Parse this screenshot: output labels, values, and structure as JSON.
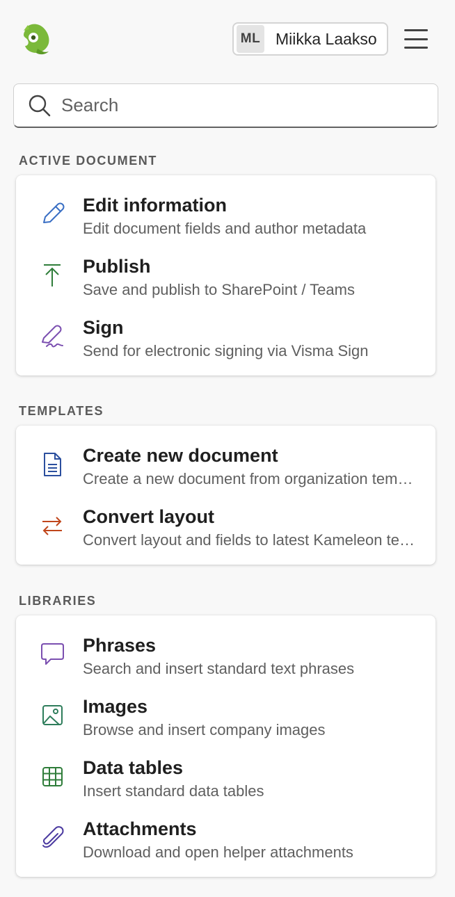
{
  "header": {
    "user_initials": "ML",
    "user_name": "Miikka Laakso",
    "logo_icon": "chameleon-logo",
    "menu_icon": "hamburger-menu-icon"
  },
  "search": {
    "placeholder": "Search"
  },
  "sections": {
    "active_document": {
      "title": "ACTIVE DOCUMENT",
      "items": [
        {
          "title": "Edit information",
          "desc": "Edit document fields and author metadata",
          "icon": "pencil-icon",
          "color": "#3a6fc4"
        },
        {
          "title": "Publish",
          "desc": "Save and publish to SharePoint / Teams",
          "icon": "upload-arrow-icon",
          "color": "#2f7d3a"
        },
        {
          "title": "Sign",
          "desc": "Send for electronic signing via Visma Sign",
          "icon": "signature-pen-icon",
          "color": "#7b4fb0"
        }
      ]
    },
    "templates": {
      "title": "TEMPLATES",
      "items": [
        {
          "title": "Create new document",
          "desc": "Create a new document from organization templates",
          "icon": "document-icon",
          "color": "#2b4f9e"
        },
        {
          "title": "Convert layout",
          "desc": "Convert layout and fields to latest Kameleon templates",
          "icon": "swap-arrows-icon",
          "color": "#c0461b"
        }
      ]
    },
    "libraries": {
      "title": "LIBRARIES",
      "items": [
        {
          "title": "Phrases",
          "desc": "Search and insert standard text phrases",
          "icon": "speech-bubble-icon",
          "color": "#7b4fb0"
        },
        {
          "title": "Images",
          "desc": "Browse and insert company images",
          "icon": "image-icon",
          "color": "#2e7d5b"
        },
        {
          "title": "Data tables",
          "desc": "Insert standard data tables",
          "icon": "table-grid-icon",
          "color": "#2f7d3a"
        },
        {
          "title": "Attachments",
          "desc": "Download and open helper attachments",
          "icon": "paperclip-icon",
          "color": "#4b3aa0"
        }
      ]
    }
  }
}
